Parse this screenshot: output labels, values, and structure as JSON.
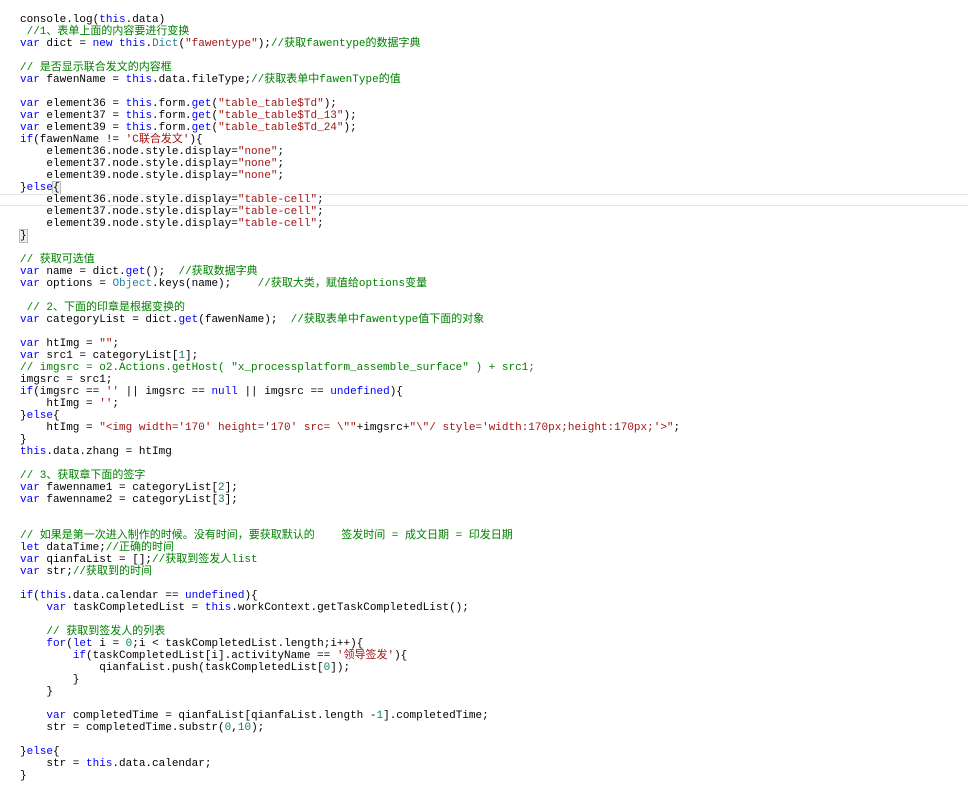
{
  "code": {
    "current_line": 15,
    "lines": [
      [
        [
          "p",
          "console.log("
        ],
        [
          "k",
          "this"
        ],
        [
          "p",
          ".data)"
        ]
      ],
      [
        [
          "c",
          " //1、表单上面的内容要进行变换"
        ]
      ],
      [
        [
          "k",
          "var"
        ],
        [
          "p",
          " dict = "
        ],
        [
          "k",
          "new"
        ],
        [
          "p",
          " "
        ],
        [
          "k",
          "this"
        ],
        [
          "p",
          "."
        ],
        [
          "t",
          "Dict"
        ],
        [
          "p",
          "("
        ],
        [
          "s",
          "\"fawentype\""
        ],
        [
          "p",
          ");"
        ],
        [
          "c",
          "//获取fawentype的数据字典"
        ]
      ],
      [],
      [
        [
          "c",
          "// 是否显示联合发文的内容框"
        ]
      ],
      [
        [
          "k",
          "var"
        ],
        [
          "p",
          " fawenName = "
        ],
        [
          "k",
          "this"
        ],
        [
          "p",
          ".data.fileType;"
        ],
        [
          "c",
          "//获取表单中fawenType的值"
        ]
      ],
      [],
      [
        [
          "k",
          "var"
        ],
        [
          "p",
          " element36 = "
        ],
        [
          "k",
          "this"
        ],
        [
          "p",
          ".form."
        ],
        [
          "k",
          "get"
        ],
        [
          "p",
          "("
        ],
        [
          "s",
          "\"table_table$Td\""
        ],
        [
          "p",
          ");"
        ]
      ],
      [
        [
          "k",
          "var"
        ],
        [
          "p",
          " element37 = "
        ],
        [
          "k",
          "this"
        ],
        [
          "p",
          ".form."
        ],
        [
          "k",
          "get"
        ],
        [
          "p",
          "("
        ],
        [
          "s",
          "\"table_table$Td_13\""
        ],
        [
          "p",
          ");"
        ]
      ],
      [
        [
          "k",
          "var"
        ],
        [
          "p",
          " element39 = "
        ],
        [
          "k",
          "this"
        ],
        [
          "p",
          ".form."
        ],
        [
          "k",
          "get"
        ],
        [
          "p",
          "("
        ],
        [
          "s",
          "\"table_table$Td_24\""
        ],
        [
          "p",
          ");"
        ]
      ],
      [
        [
          "k",
          "if"
        ],
        [
          "p",
          "(fawenName != "
        ],
        [
          "s",
          "'C联合发文'"
        ],
        [
          "p",
          "){"
        ]
      ],
      [
        [
          "p",
          "    element36.node.style.display="
        ],
        [
          "s",
          "\"none\""
        ],
        [
          "p",
          ";"
        ]
      ],
      [
        [
          "p",
          "    element37.node.style.display="
        ],
        [
          "s",
          "\"none\""
        ],
        [
          "p",
          ";"
        ]
      ],
      [
        [
          "p",
          "    element39.node.style.display="
        ],
        [
          "s",
          "\"none\""
        ],
        [
          "p",
          ";"
        ]
      ],
      [
        [
          "p",
          "}"
        ],
        [
          "k",
          "else"
        ],
        [
          "b",
          "{"
        ]
      ],
      [
        [
          "p",
          "    element36.node.style.display="
        ],
        [
          "s",
          "\"table-cell\""
        ],
        [
          "p",
          ";"
        ]
      ],
      [
        [
          "p",
          "    element37.node.style.display="
        ],
        [
          "s",
          "\"table-cell\""
        ],
        [
          "p",
          ";"
        ]
      ],
      [
        [
          "p",
          "    element39.node.style.display="
        ],
        [
          "s",
          "\"table-cell\""
        ],
        [
          "p",
          ";"
        ]
      ],
      [
        [
          "b",
          "}"
        ]
      ],
      [],
      [
        [
          "c",
          "// 获取可选值"
        ]
      ],
      [
        [
          "k",
          "var"
        ],
        [
          "p",
          " name = dict."
        ],
        [
          "k",
          "get"
        ],
        [
          "p",
          "();  "
        ],
        [
          "c",
          "//获取数据字典"
        ]
      ],
      [
        [
          "k",
          "var"
        ],
        [
          "p",
          " options = "
        ],
        [
          "t",
          "Object"
        ],
        [
          "p",
          ".keys(name);    "
        ],
        [
          "c",
          "//获取大类，赋值给options变量"
        ]
      ],
      [],
      [
        [
          "c",
          " // 2、下面的印章是根据变换的"
        ]
      ],
      [
        [
          "k",
          "var"
        ],
        [
          "p",
          " categoryList = dict."
        ],
        [
          "k",
          "get"
        ],
        [
          "p",
          "(fawenName);  "
        ],
        [
          "c",
          "//获取表单中fawentype值下面的对象"
        ]
      ],
      [],
      [
        [
          "k",
          "var"
        ],
        [
          "p",
          " htImg = "
        ],
        [
          "s",
          "\"\""
        ],
        [
          "p",
          ";"
        ]
      ],
      [
        [
          "k",
          "var"
        ],
        [
          "p",
          " src1 = categoryList["
        ],
        [
          "n",
          "1"
        ],
        [
          "p",
          "];"
        ]
      ],
      [
        [
          "c",
          "// imgsrc = o2.Actions.getHost( \"x_processplatform_assemble_surface\" ) + src1;"
        ]
      ],
      [
        [
          "p",
          "imgsrc = src1;"
        ]
      ],
      [
        [
          "k",
          "if"
        ],
        [
          "p",
          "(imgsrc == "
        ],
        [
          "s",
          "''"
        ],
        [
          "p",
          " || imgsrc == "
        ],
        [
          "k",
          "null"
        ],
        [
          "p",
          " || imgsrc == "
        ],
        [
          "k",
          "undefined"
        ],
        [
          "p",
          "){"
        ]
      ],
      [
        [
          "p",
          "    htImg = "
        ],
        [
          "s",
          "''"
        ],
        [
          "p",
          ";"
        ]
      ],
      [
        [
          "p",
          "}"
        ],
        [
          "k",
          "else"
        ],
        [
          "p",
          "{"
        ]
      ],
      [
        [
          "p",
          "    htImg = "
        ],
        [
          "s",
          "\"<img width='170' height='170' src= \\\"\""
        ],
        [
          "p",
          "+imgsrc+"
        ],
        [
          "s",
          "\"\\\"/ style='width:170px;height:170px;'>\""
        ],
        [
          "p",
          ";"
        ]
      ],
      [
        [
          "p",
          "}"
        ]
      ],
      [
        [
          "k",
          "this"
        ],
        [
          "p",
          ".data.zhang = htImg"
        ]
      ],
      [],
      [
        [
          "c",
          "// 3、获取章下面的签字"
        ]
      ],
      [
        [
          "k",
          "var"
        ],
        [
          "p",
          " fawenname1 = categoryList["
        ],
        [
          "n",
          "2"
        ],
        [
          "p",
          "];"
        ]
      ],
      [
        [
          "k",
          "var"
        ],
        [
          "p",
          " fawenname2 = categoryList["
        ],
        [
          "n",
          "3"
        ],
        [
          "p",
          "];"
        ]
      ],
      [],
      [],
      [
        [
          "c",
          "// 如果是第一次进入制作的时候。没有时间，要获取默认的    签发时间 = 成文日期 = 印发日期"
        ]
      ],
      [
        [
          "k",
          "let"
        ],
        [
          "p",
          " dataTime;"
        ],
        [
          "c",
          "//正确的时间"
        ]
      ],
      [
        [
          "k",
          "var"
        ],
        [
          "p",
          " qianfaList = [];"
        ],
        [
          "c",
          "//获取到签发人list"
        ]
      ],
      [
        [
          "k",
          "var"
        ],
        [
          "p",
          " str;"
        ],
        [
          "c",
          "//获取到的时间"
        ]
      ],
      [],
      [
        [
          "k",
          "if"
        ],
        [
          "p",
          "("
        ],
        [
          "k",
          "this"
        ],
        [
          "p",
          ".data.calendar == "
        ],
        [
          "k",
          "undefined"
        ],
        [
          "p",
          "){"
        ]
      ],
      [
        [
          "p",
          "    "
        ],
        [
          "k",
          "var"
        ],
        [
          "p",
          " taskCompletedList = "
        ],
        [
          "k",
          "this"
        ],
        [
          "p",
          ".workContext.getTaskCompletedList();"
        ]
      ],
      [],
      [
        [
          "p",
          "    "
        ],
        [
          "c",
          "// 获取到签发人的列表"
        ]
      ],
      [
        [
          "p",
          "    "
        ],
        [
          "k",
          "for"
        ],
        [
          "p",
          "("
        ],
        [
          "k",
          "let"
        ],
        [
          "p",
          " i = "
        ],
        [
          "n",
          "0"
        ],
        [
          "p",
          ";i < taskCompletedList.length;i++){"
        ]
      ],
      [
        [
          "p",
          "        "
        ],
        [
          "k",
          "if"
        ],
        [
          "p",
          "(taskCompletedList[i].activityName == "
        ],
        [
          "s",
          "'领导签发'"
        ],
        [
          "p",
          "){"
        ]
      ],
      [
        [
          "p",
          "            qianfaList.push(taskCompletedList["
        ],
        [
          "n",
          "0"
        ],
        [
          "p",
          "]);"
        ]
      ],
      [
        [
          "p",
          "        }"
        ]
      ],
      [
        [
          "p",
          "    }"
        ]
      ],
      [],
      [
        [
          "p",
          "    "
        ],
        [
          "k",
          "var"
        ],
        [
          "p",
          " completedTime = qianfaList[qianfaList.length -"
        ],
        [
          "n",
          "1"
        ],
        [
          "p",
          "].completedTime;"
        ]
      ],
      [
        [
          "p",
          "    str = completedTime.substr("
        ],
        [
          "n",
          "0"
        ],
        [
          "p",
          ","
        ],
        [
          "n",
          "10"
        ],
        [
          "p",
          ");"
        ]
      ],
      [],
      [
        [
          "p",
          "}"
        ],
        [
          "k",
          "else"
        ],
        [
          "p",
          "{"
        ]
      ],
      [
        [
          "p",
          "    str = "
        ],
        [
          "k",
          "this"
        ],
        [
          "p",
          ".data.calendar;"
        ]
      ],
      [
        [
          "p",
          "}"
        ]
      ]
    ]
  }
}
